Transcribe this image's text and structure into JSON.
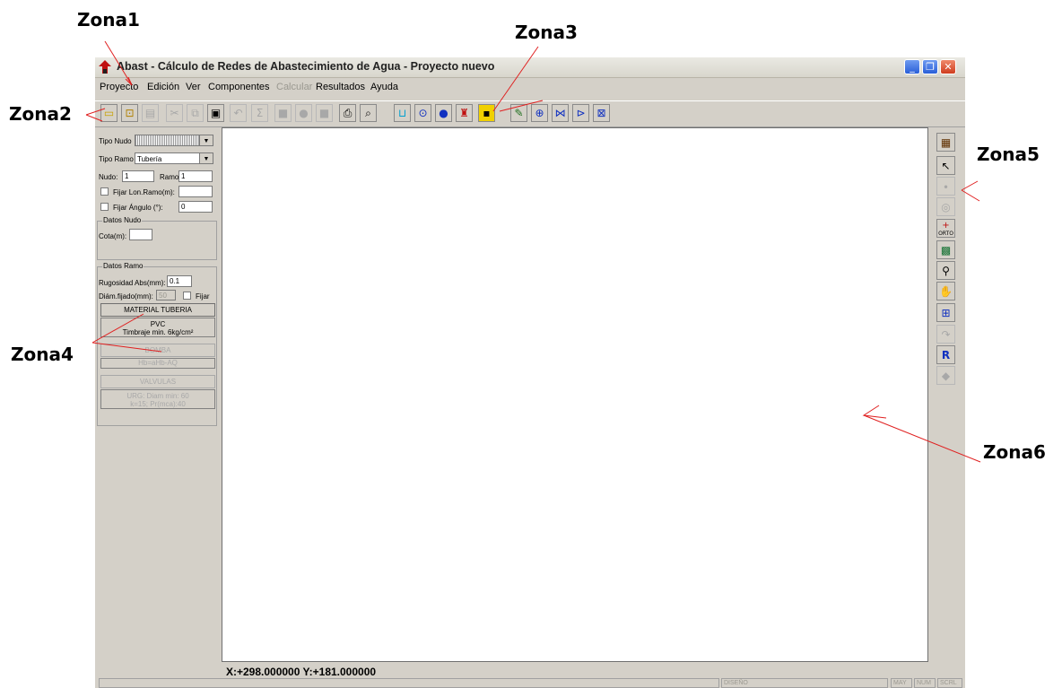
{
  "annotations": {
    "zona1": "Zona1",
    "zona2": "Zona2",
    "zona3": "Zona3",
    "zona4": "Zona4",
    "zona5": "Zona5",
    "zona6": "Zona6",
    "arrow_color": "#e02020"
  },
  "window": {
    "title": "Abast - Cálculo de Redes de Abastecimiento de Agua - Proyecto nuevo",
    "minimize": "_",
    "restore": "❐",
    "close": "✕"
  },
  "menu": {
    "proyecto": "Proyecto",
    "edicion": "Edición",
    "ver": "Ver",
    "componentes": "Componentes",
    "calcular": "Calcular",
    "resultados": "Resultados",
    "ayuda": "Ayuda"
  },
  "toolbar_icons": [
    "new-project-icon",
    "open-icon",
    "save-icon",
    "cut-icon",
    "copy-icon",
    "paste-icon",
    "undo-icon",
    "sum-icon",
    "gray-block-icon",
    "gray-block-icon",
    "gray-block-icon",
    "print-icon",
    "print-preview-icon",
    "reservoir-icon",
    "node-ring-icon",
    "node-icon",
    "hydrant-icon",
    "marker-icon",
    "pencil-icon",
    "pump-icon",
    "valve-icon",
    "check-valve-icon",
    "regulator-icon"
  ],
  "panel": {
    "tipo_nodo_label": "Tipo Nudo",
    "tipo_nodo_value": "",
    "tipo_ramo_label": "Tipo Ramo",
    "tipo_ramo_value": "Tubería",
    "nudo_label": "Nudo:",
    "nudo_value": "1",
    "ramo_label": "Ramo:",
    "ramo_value": "1",
    "fijar_lon_label": "Fijar Lon.Ramo(m):",
    "fijar_angulo_label": "Fijar Ángulo (°):",
    "angulo_value": "0",
    "datos_nudo_title": "Datos Nudo",
    "cota_label": "Cota(m):",
    "cota_value": "",
    "datos_ramo_title": "Datos Ramo",
    "rugosidad_label": "Rugosidad Abs(mm):",
    "rugosidad_value": "0.1",
    "diam_label": "Diám.fijado(mm):",
    "diam_value": "50",
    "fijar_label": "Fijar",
    "material_button": "MATERIAL TUBERIA",
    "material_info": "PVC\nTimbraje min. 6kg/cm²",
    "bomba_button": "BOMBA",
    "bomba_info": "Hb=aHb-AQ",
    "valvulas_button": "VALVULAS",
    "valvulas_info": "URG: Diam min: 60\nk=15; Pr(mca):40"
  },
  "right_toolbar_icons": [
    "floppy-map-icon",
    "pointer-icon",
    "ehd-icon",
    "node-view-icon",
    "orto-icon",
    "zoom-window-icon",
    "zoom-icon",
    "pan-hand-icon",
    "zoom-extents-icon",
    "redo-icon",
    "r-icon",
    "eraser-icon"
  ],
  "right_toolbar": {
    "orto_text": "ORTO",
    "r_text": "R"
  },
  "coords": "X:+298.000000 Y:+181.000000",
  "status": {
    "mode": "DISEÑO",
    "may": "MAY",
    "num": "NUM",
    "scrl": "SCRL"
  }
}
